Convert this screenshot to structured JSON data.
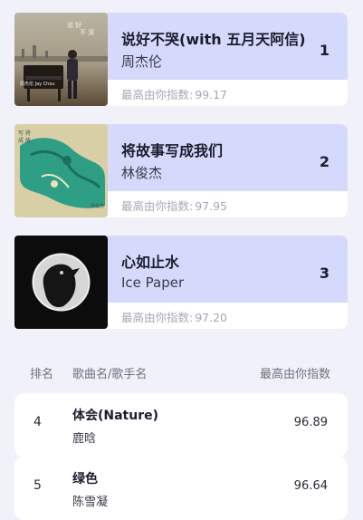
{
  "top_cards": [
    {
      "title": "说好不哭(with 五月天阿信)",
      "artist": "周杰伦",
      "rank": "1",
      "score_label": "最高由你指数:",
      "score_value": "99.17",
      "cover_icon": "album-cover-piano-icon",
      "cover_text": "说好不哭",
      "cover_caption": "周杰伦 Jay Chou"
    },
    {
      "title": "将故事写成我们",
      "artist": "林俊杰",
      "rank": "2",
      "score_label": "最高由你指数:",
      "score_value": "97.95",
      "cover_icon": "album-cover-green-art-icon",
      "cover_text": "将故事写成我们",
      "cover_caption": "林俊杰"
    },
    {
      "title": "心如止水",
      "artist": "Ice Paper",
      "rank": "3",
      "score_label": "最高由你指数:",
      "score_value": "97.20",
      "cover_icon": "album-cover-crow-icon"
    }
  ],
  "table_header": {
    "rank": "排名",
    "song_artist": "歌曲名/歌手名",
    "score": "最高由你指数"
  },
  "rows": [
    {
      "rank": "4",
      "title": "体会(Nature)",
      "artist": "鹿晗",
      "score": "96.89"
    },
    {
      "rank": "5",
      "title": "绿色",
      "artist": "陈雪凝",
      "score": "96.64"
    }
  ],
  "colors": {
    "background": "#f0f1f9",
    "card_header": "#d5d9fb",
    "score_text": "#a6a8b8"
  }
}
